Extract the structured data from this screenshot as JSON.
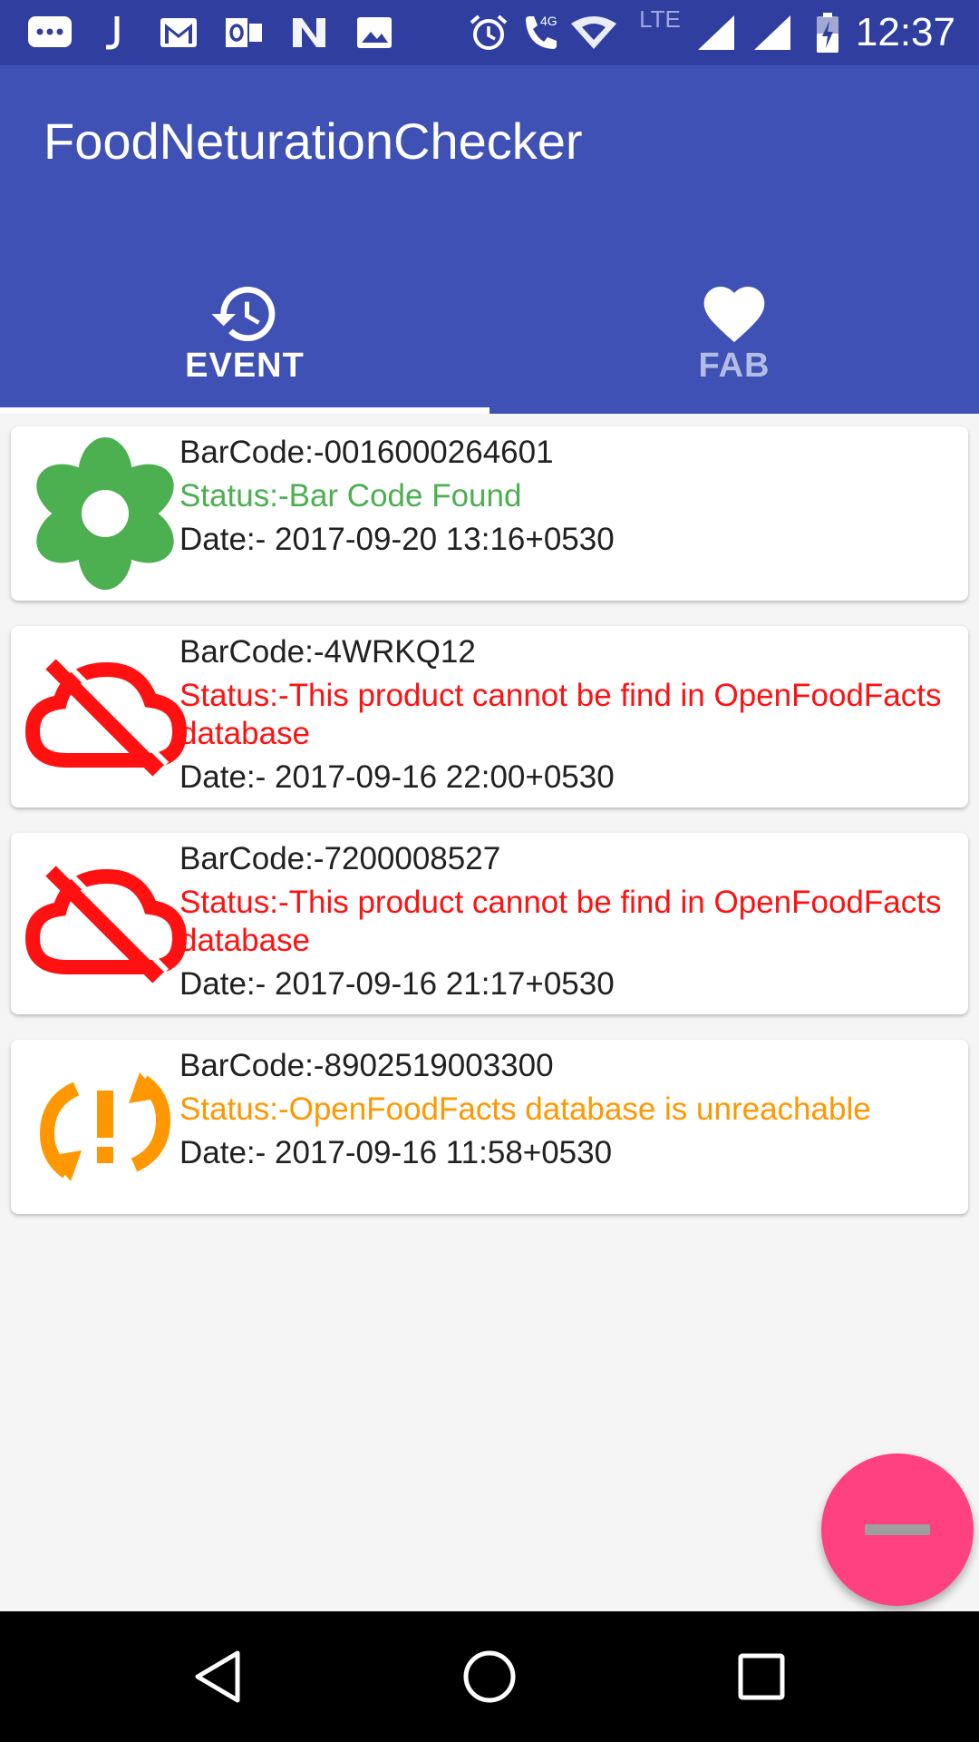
{
  "status_bar": {
    "time": "12:37",
    "network_label": "LTE",
    "call_badge": "4G",
    "icons": [
      "chat-icon",
      "j-app-icon",
      "gmail-icon",
      "outlook-icon",
      "n-app-icon",
      "gallery-icon",
      "alarm-icon",
      "call-icon",
      "wifi-icon",
      "signal-icon",
      "signal-icon",
      "battery-charging-icon"
    ]
  },
  "app_bar": {
    "title": "FoodNeturationChecker"
  },
  "tabs": [
    {
      "label": "EVENT",
      "icon": "history-icon",
      "selected": true
    },
    {
      "label": "FAB",
      "icon": "heart-icon",
      "selected": false
    }
  ],
  "events": [
    {
      "barcode": "BarCode:-0016000264601",
      "status": "Status:-Bar Code Found",
      "date": "Date:-  2017-09-20 13:16+0530",
      "status_color": "#4caf50",
      "icon": "flower-icon"
    },
    {
      "barcode": "BarCode:-4WRKQ12",
      "status": "Status:-This product cannot be find in OpenFoodFacts database",
      "date": "Date:-  2017-09-16 22:00+0530",
      "status_color": "#ff1111",
      "icon": "cloud-off-icon"
    },
    {
      "barcode": "BarCode:-7200008527",
      "status": "Status:-This product cannot be find in OpenFoodFacts database",
      "date": "Date:-  2017-09-16 21:17+0530",
      "status_color": "#ff1111",
      "icon": "cloud-off-icon"
    },
    {
      "barcode": "BarCode:-8902519003300",
      "status": "Status:-OpenFoodFacts database is unreachable",
      "date": "Date:-  2017-09-16 11:58+0530",
      "status_color": "#ff9800",
      "icon": "sync-problem-icon"
    }
  ],
  "fab": {
    "icon": "minus-icon",
    "color": "#ff4081"
  },
  "colors": {
    "primary": "#3f51b5",
    "primary_dark": "#303f9f",
    "accent": "#ff4081"
  },
  "nav_bar": {
    "icons": [
      "back-icon",
      "home-icon",
      "recents-icon"
    ]
  }
}
